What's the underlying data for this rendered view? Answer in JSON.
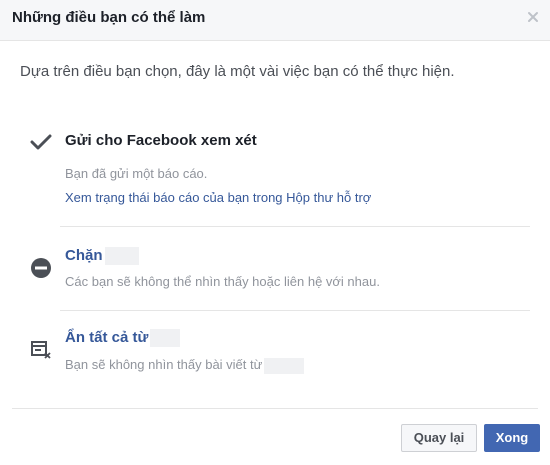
{
  "dialog": {
    "title": "Những điều bạn có thể làm",
    "close_icon": "close-icon",
    "intro": "Dựa trên điều bạn chọn, đây là một vài việc bạn có thể thực hiện."
  },
  "options": [
    {
      "icon": "checkmark-icon",
      "title": "Gửi cho Facebook xem xét",
      "description": "Bạn đã gửi một báo cáo.",
      "link": "Xem trạng thái báo cáo của bạn trong Hộp thư hỗ trợ"
    },
    {
      "icon": "block-icon",
      "title": "Chặn",
      "description": "Các bạn sẽ không thể nhìn thấy hoặc liên hệ với nhau."
    },
    {
      "icon": "hide-all-icon",
      "title": "Ẩn tất cả từ",
      "description": "Bạn sẽ không nhìn thấy bài viết từ"
    }
  ],
  "buttons": {
    "back_label": "Quay lại",
    "done_label": "Xong"
  },
  "colors": {
    "link": "#365899",
    "primary": "#4267b2",
    "muted_text": "#90949c"
  }
}
